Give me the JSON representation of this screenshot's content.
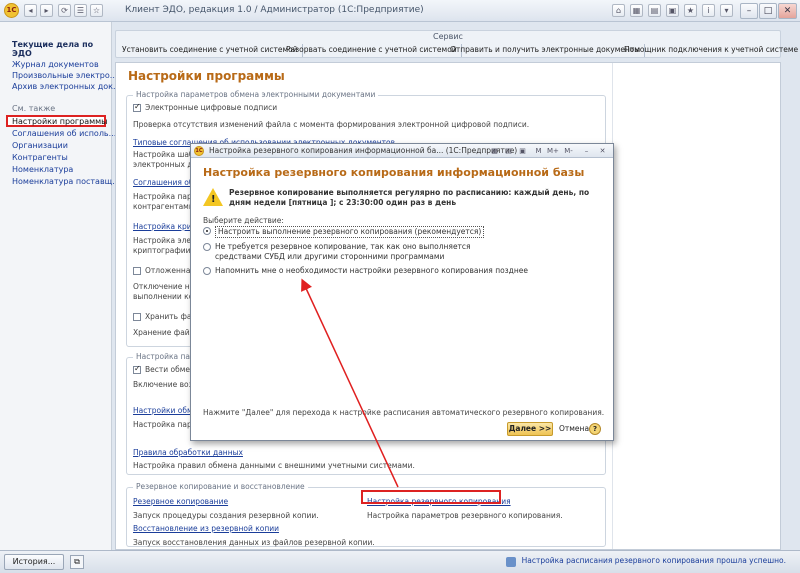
{
  "window": {
    "title": "Клиент ЭДО, редакция 1.0 / Администратор  (1С:Предприятие)"
  },
  "left_panel": {
    "title": "Текущие дела по ЭДО",
    "items": [
      "Журнал документов",
      "Произвольные электро...",
      "Архив электронных док..."
    ],
    "see_also": "См. также",
    "see_also_items": [
      "Настройки программы",
      "Соглашения об исполь...",
      "Организации",
      "Контрагенты",
      "Номенклатура",
      "Номенклатура поставщ..."
    ]
  },
  "service": {
    "title": "Сервис",
    "buttons": [
      "Установить соединение с учетной системой",
      "Разорвать соединение с учетной системой",
      "Отправить и получить электронные документы",
      "Помощник подключения к учетной системе"
    ]
  },
  "main": {
    "title": "Настройки программы",
    "group1": {
      "title": "Настройка параметров обмена электронными документами",
      "checkbox_signatures": "Электронные цифровые подписи",
      "signatures_desc": "Проверка отсутствия изменений файла с момента формирования электронной цифровой подписи.",
      "link_typical": "Типовые соглашения об использовании электронных документов",
      "typical_desc": [
        "Настройка шабло",
        "электронных док"
      ],
      "link_agreements": "Соглашения об и",
      "agreements_desc": [
        "Настройка парам",
        "контрагентами."
      ],
      "link_crypto": "Настройка крипт",
      "crypto_desc": [
        "Настройка электр",
        "криптографии дл"
      ],
      "checkbox_deferred": "Отложенная о",
      "deferred_desc": [
        "Отключение неме",
        "выполнении кома"
      ],
      "checkbox_store": "Хранить файлы",
      "store_desc": "Хранение файлов"
    },
    "group2": {
      "title": "Настройка параметров",
      "checkbox_exchange": "Вести обмен",
      "exchange_desc": "Включение возмо",
      "link_settings": "Настройки обмен",
      "settings_desc": "Настройка парам",
      "link_rules": "Правила обработки данных",
      "rules_desc": "Настройка правил обмена данными с внешними учетными системами."
    },
    "group3": {
      "title": "Резервное копирование и восстановление",
      "link_backup": "Резервное копирование",
      "backup_desc": "Запуск процедуры создания резервной копии.",
      "link_backup_settings": "Настройка резервного копирования",
      "backup_settings_desc": "Настройка параметров резервного копирования.",
      "link_restore": "Восстановление из резервной копии",
      "restore_desc": "Запуск восстановления данных из файлов резервной копии."
    }
  },
  "dialog": {
    "title": "Настройка резервного копирования информационной ба...  (1С:Предприятие)",
    "heading": "Настройка резервного копирования информационной базы",
    "warning": "Резервное копирование выполняется регулярно по расписанию: каждый  день, по дням недели [пятница ]; с 23:30:00 один раз в день",
    "choose_label": "Выберите действие:",
    "options": [
      "Настроить выполнение резервного копирования (рекомендуется)",
      "Не требуется резервное копирование, так как оно выполняется средствами СУБД или другими сторонними программами",
      "Напомнить мне о необходимости настройки резервного копирования позднее"
    ],
    "note": "Нажмите \"Далее\" для перехода к настройке расписания автоматического резервного копирования.",
    "next_label": "Далее >>",
    "cancel_label": "Отмена",
    "help_label": "?"
  },
  "statusbar": {
    "history_label": "История...",
    "message": "Настройка расписания резервного копирования прошла успешно."
  },
  "colors": {
    "accent_title": "#b86a17",
    "link": "#1a3d9a",
    "highlight": "#dd2222"
  }
}
